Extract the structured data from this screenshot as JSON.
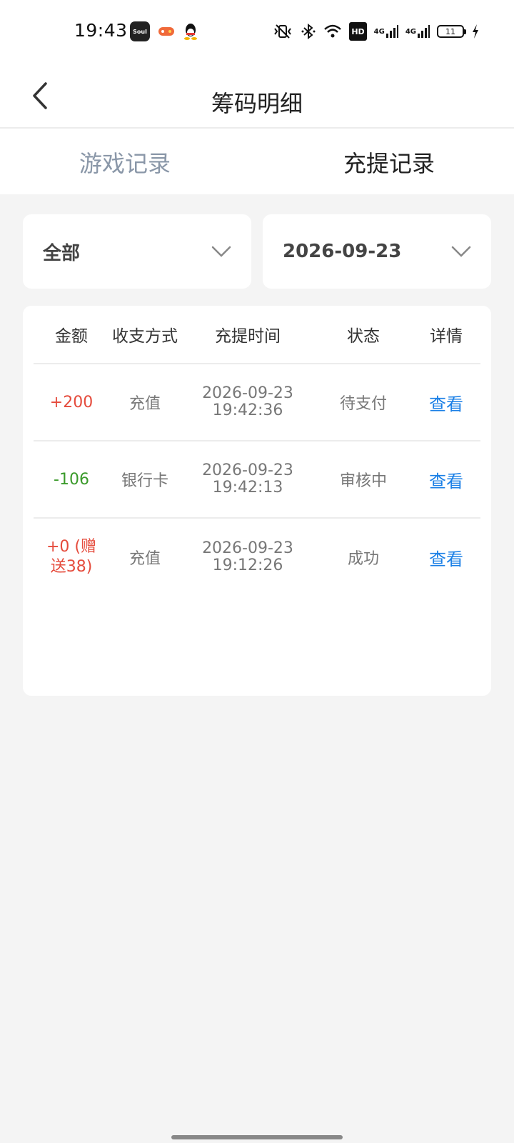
{
  "status_bar": {
    "time": "19:43",
    "hd_label": "HD",
    "net1": "4G",
    "net2": "4G",
    "battery": "11"
  },
  "header": {
    "title": "筹码明细"
  },
  "tabs": [
    {
      "label": "游戏记录",
      "active": false
    },
    {
      "label": "充提记录",
      "active": true
    }
  ],
  "filters": {
    "type_value": "全部",
    "date_value": "2026-09-23"
  },
  "table": {
    "columns": [
      "金额",
      "收支方式",
      "充提时间",
      "状态",
      "详情"
    ],
    "rows": [
      {
        "amount": "+200",
        "method": "充值",
        "date": "2026-09-23",
        "time": "19:42:36",
        "status": "待支付",
        "detail": "查看"
      },
      {
        "amount": "-106",
        "method": "银行卡",
        "date": "2026-09-23",
        "time": "19:42:13",
        "status": "审核中",
        "detail": "查看"
      },
      {
        "amount_line1": "+0 (赠",
        "amount_line2": "送38)",
        "method": "充值",
        "date": "2026-09-23",
        "time": "19:12:26",
        "status": "成功",
        "detail": "查看"
      }
    ]
  },
  "colors": {
    "income": "#e54b3c",
    "expense": "#3a9a2a",
    "link": "#1a7fe6",
    "inactive_tab": "#8a97a8"
  }
}
